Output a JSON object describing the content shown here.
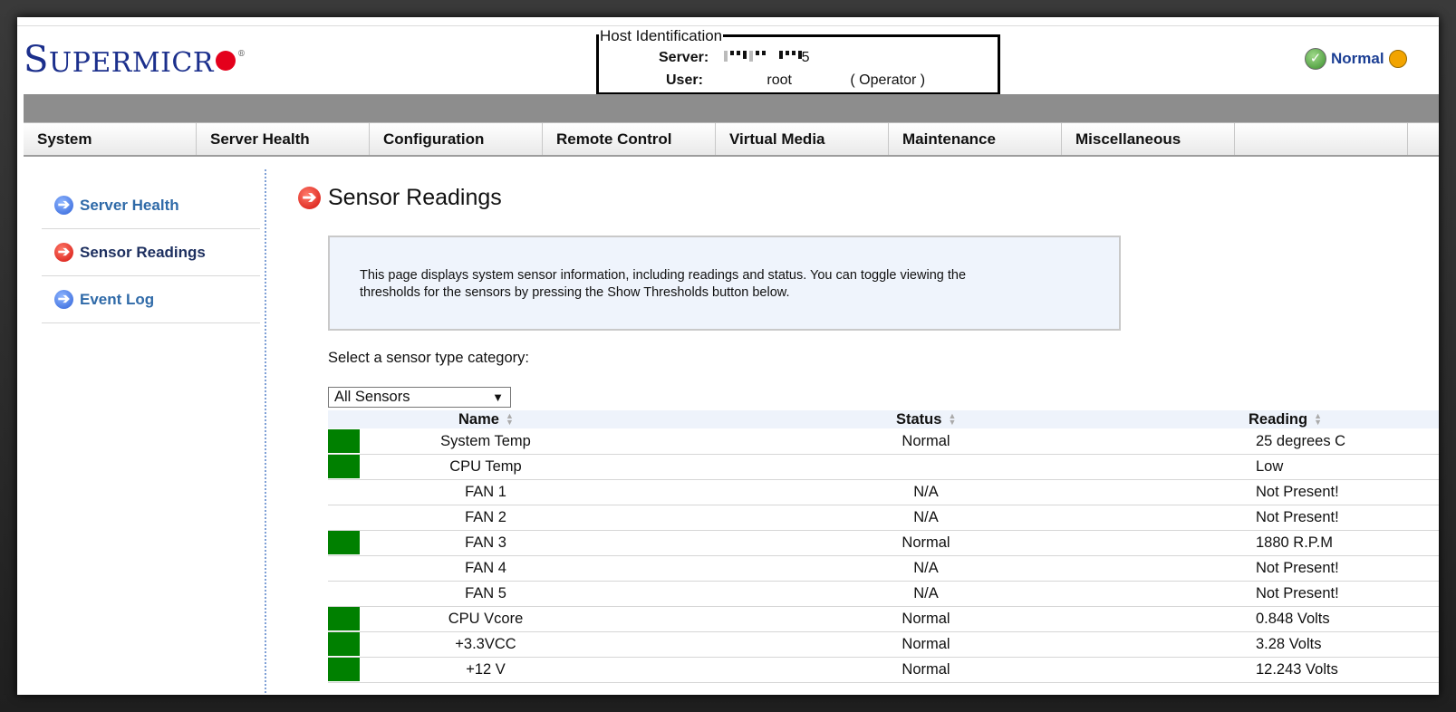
{
  "brand": {
    "logo_big_s": "S",
    "logo_rest": "UPERMICR",
    "logo_reg": "®"
  },
  "host": {
    "legend": "Host Identification",
    "server_label": "Server:",
    "server_suffix": "5",
    "user_label": "User:",
    "user_value": "root",
    "user_role": "( Operator )"
  },
  "status": {
    "label": "Normal"
  },
  "menu": [
    "System",
    "Server Health",
    "Configuration",
    "Remote Control",
    "Virtual Media",
    "Maintenance",
    "Miscellaneous"
  ],
  "sidebar": [
    {
      "label": "Server Health",
      "active": false
    },
    {
      "label": "Sensor Readings",
      "active": true
    },
    {
      "label": "Event Log",
      "active": false
    }
  ],
  "page": {
    "title": "Sensor Readings",
    "info_line1": "This page displays system sensor information, including readings and status. You can toggle viewing the",
    "info_line2": "thresholds for the sensors by pressing the Show Thresholds button below.",
    "select_label": "Select a sensor type category:",
    "select_value": "All Sensors"
  },
  "table": {
    "headers": {
      "name": "Name",
      "status": "Status",
      "reading": "Reading"
    },
    "rows": [
      {
        "ok": true,
        "name": "System Temp",
        "status": "Normal",
        "reading": "25 degrees C"
      },
      {
        "ok": true,
        "name": "CPU Temp",
        "status": "",
        "reading": "Low"
      },
      {
        "ok": false,
        "name": "FAN 1",
        "status": "N/A",
        "reading": "Not Present!"
      },
      {
        "ok": false,
        "name": "FAN 2",
        "status": "N/A",
        "reading": "Not Present!"
      },
      {
        "ok": true,
        "name": "FAN 3",
        "status": "Normal",
        "reading": "1880 R.P.M"
      },
      {
        "ok": false,
        "name": "FAN 4",
        "status": "N/A",
        "reading": "Not Present!"
      },
      {
        "ok": false,
        "name": "FAN 5",
        "status": "N/A",
        "reading": "Not Present!"
      },
      {
        "ok": true,
        "name": "CPU Vcore",
        "status": "Normal",
        "reading": "0.848 Volts"
      },
      {
        "ok": true,
        "name": "+3.3VCC",
        "status": "Normal",
        "reading": "3.28 Volts"
      },
      {
        "ok": true,
        "name": "+12 V",
        "status": "Normal",
        "reading": "12.243 Volts"
      }
    ]
  },
  "colors": {
    "ok_swatch": "#008000",
    "brand_blue": "#1b2f8c",
    "brand_red": "#e4001b"
  },
  "icons": {
    "status_ok": "check-circle-icon",
    "nav_arrow": "arrow-right-circle-icon",
    "sort": "sort-icon",
    "dropdown": "caret-down-icon"
  }
}
